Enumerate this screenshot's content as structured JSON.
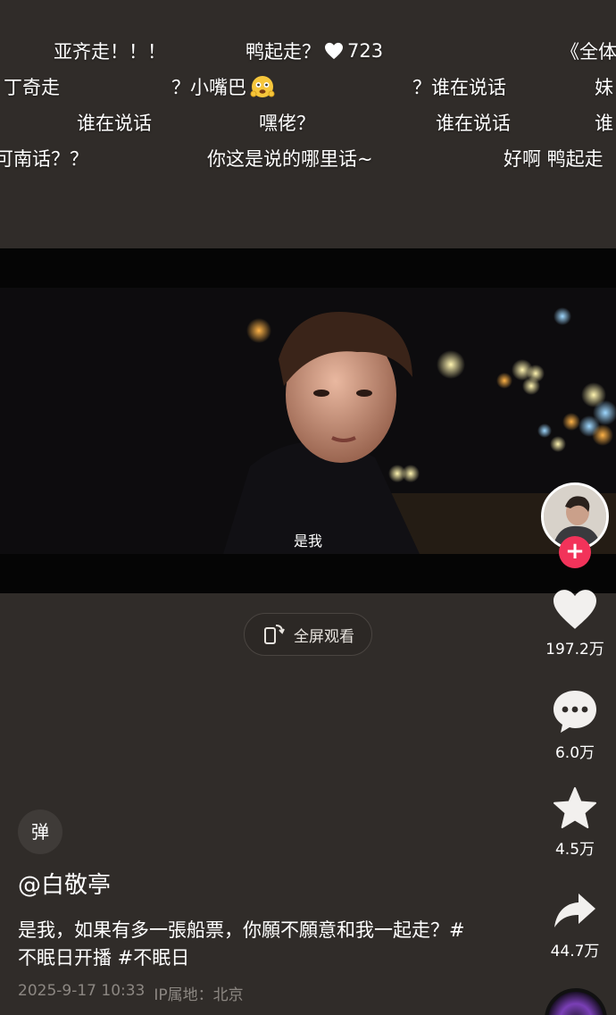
{
  "danmaku": [
    {
      "text": "亚齐走！！！"
    },
    {
      "text": "鸭起走？",
      "count": "723"
    },
    {
      "text": "《全体"
    },
    {
      "text": "丁奇走"
    },
    {
      "text": "？小嘴巴"
    },
    {
      "text": "？谁在说话"
    },
    {
      "text": "妹"
    },
    {
      "text": "谁在说话"
    },
    {
      "text": "嘿佬？"
    },
    {
      "text": "谁在说话"
    },
    {
      "text": "谁"
    },
    {
      "text": "可南话？？"
    },
    {
      "text": "你这是说的哪里话~"
    },
    {
      "text": "好啊 鸭起走"
    }
  ],
  "video": {
    "subtitle": "是我"
  },
  "fullscreen": {
    "label": "全屏观看",
    "icon": "rotate-screen-icon"
  },
  "actions": {
    "like_count": "197.2万",
    "comment_count": "6.0万",
    "favorite_count": "4.5万",
    "share_count": "44.7万"
  },
  "follow": {
    "symbol": "+"
  },
  "danmaku_toggle": {
    "label": "弹"
  },
  "post": {
    "username": "@白敬亭",
    "caption": "是我，如果有多一張船票，你願不願意和我一起走？#不眠日开播 #不眠日",
    "timestamp": "2025-9-17 10:33",
    "ip_location": "IP属地：北京"
  },
  "colors": {
    "background": "#302c29",
    "follow_red": "#f2335a",
    "meta_gray": "#8c8782"
  }
}
